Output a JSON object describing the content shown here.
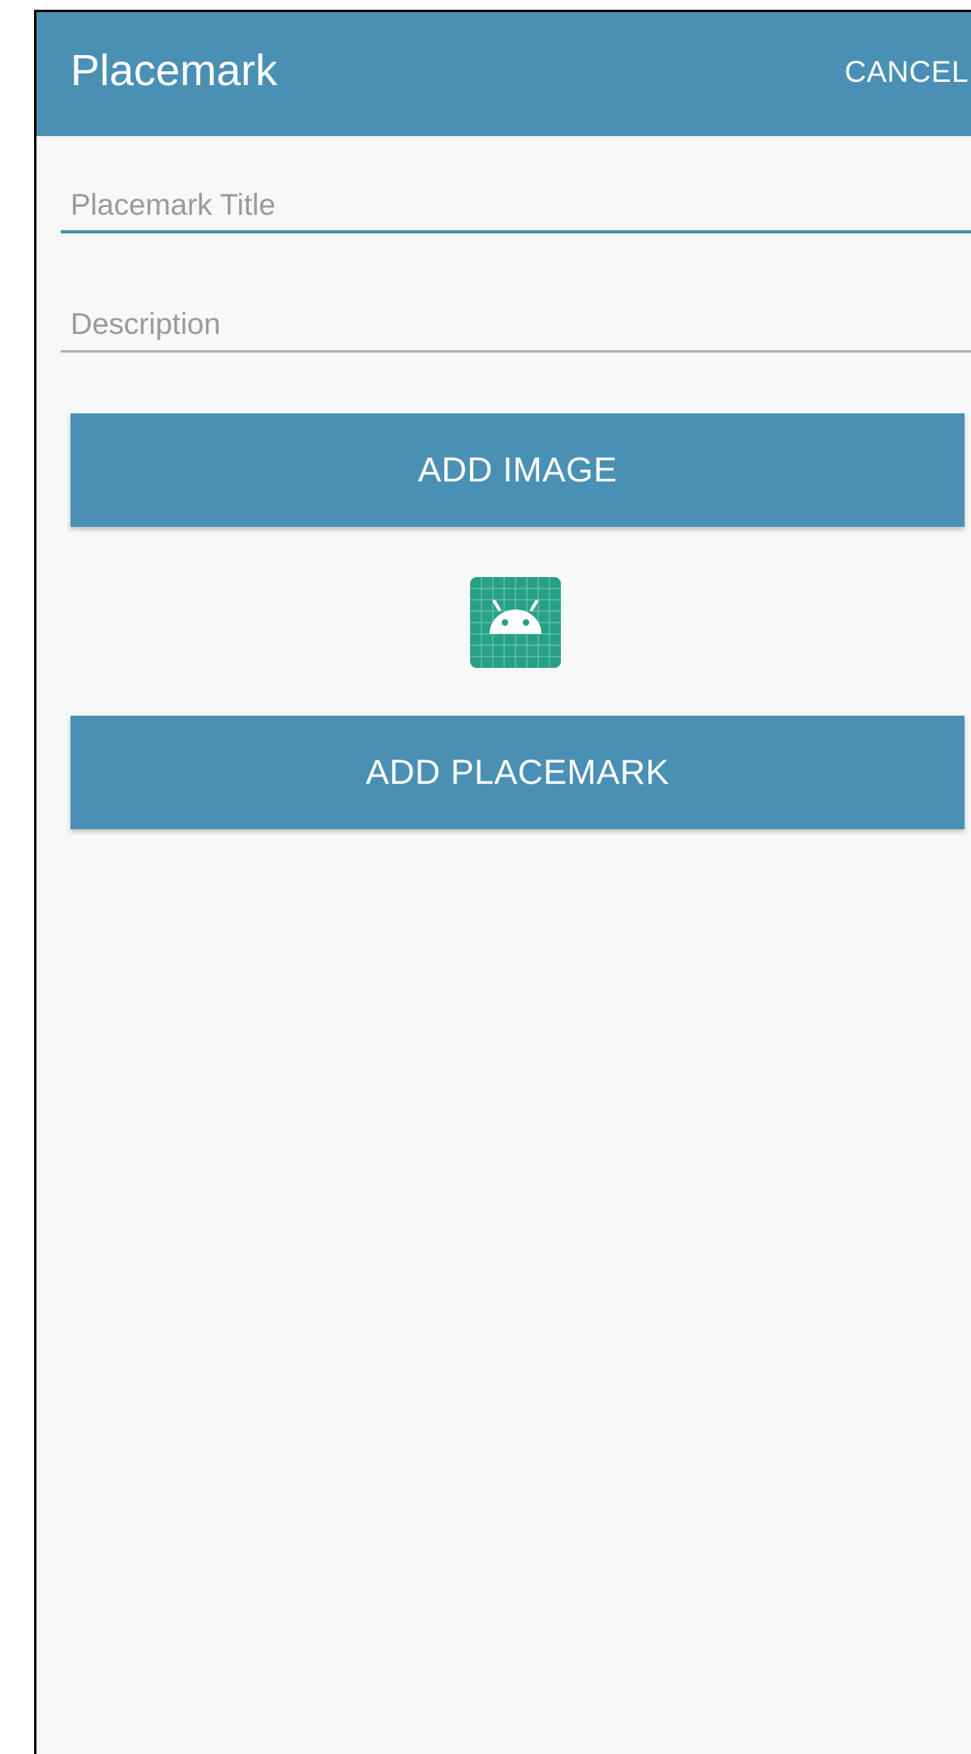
{
  "app_bar": {
    "title": "Placemark",
    "cancel_label": "CANCEL",
    "color": "#4a90b4"
  },
  "form": {
    "title_field": {
      "value": "",
      "placeholder": "Placemark Title"
    },
    "description_field": {
      "value": "",
      "placeholder": "Description"
    },
    "add_image_label": "ADD IMAGE",
    "image_preview_icon": "android-icon",
    "add_placemark_label": "ADD PLACEMARK"
  },
  "colors": {
    "primary": "#4a90b4",
    "background": "#f7f8f8",
    "preview_bg": "#27a085"
  }
}
